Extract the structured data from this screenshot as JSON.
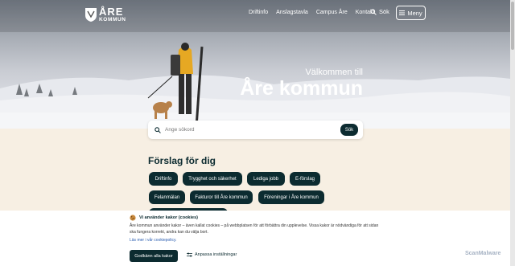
{
  "header": {
    "logo_line1": "ÅRE",
    "logo_line2": "KOMMUN",
    "nav": [
      "Driftinfo",
      "Anslagstavla",
      "Campus Åre",
      "Kontakt"
    ],
    "search_label": "Sök",
    "menu_label": "Meny"
  },
  "hero": {
    "welcome_small": "Välkommen till",
    "welcome_large": "Åre kommun"
  },
  "search": {
    "placeholder": "Ange sökord",
    "button": "Sök"
  },
  "suggestions": {
    "title": "Förslag för dig",
    "chips": [
      "Driftinfo",
      "Trygghet och säkerhet",
      "Lediga jobb",
      "E-förslag",
      "Felanmälan",
      "Fakturor till Åre kommun",
      "Föreningar i Åre kommun"
    ]
  },
  "cookie": {
    "title": "Vi använder kakor (cookies)",
    "body": "Åre kommun använder kakor – även kallat cookies – på webbplatsen för att förbättra din upplevelse. Vissa kakor är nödvändiga för att sidan ska fungera korrekt, andra kan du välja bort.",
    "link": "Läs mer i vår cookiepolicy.",
    "accept": "Godkänn alla kakor",
    "customize": "Anpassa inställningar"
  },
  "badge": "ScanMalware",
  "colors": {
    "primary": "#0c2b30",
    "background": "#f7efe3"
  }
}
